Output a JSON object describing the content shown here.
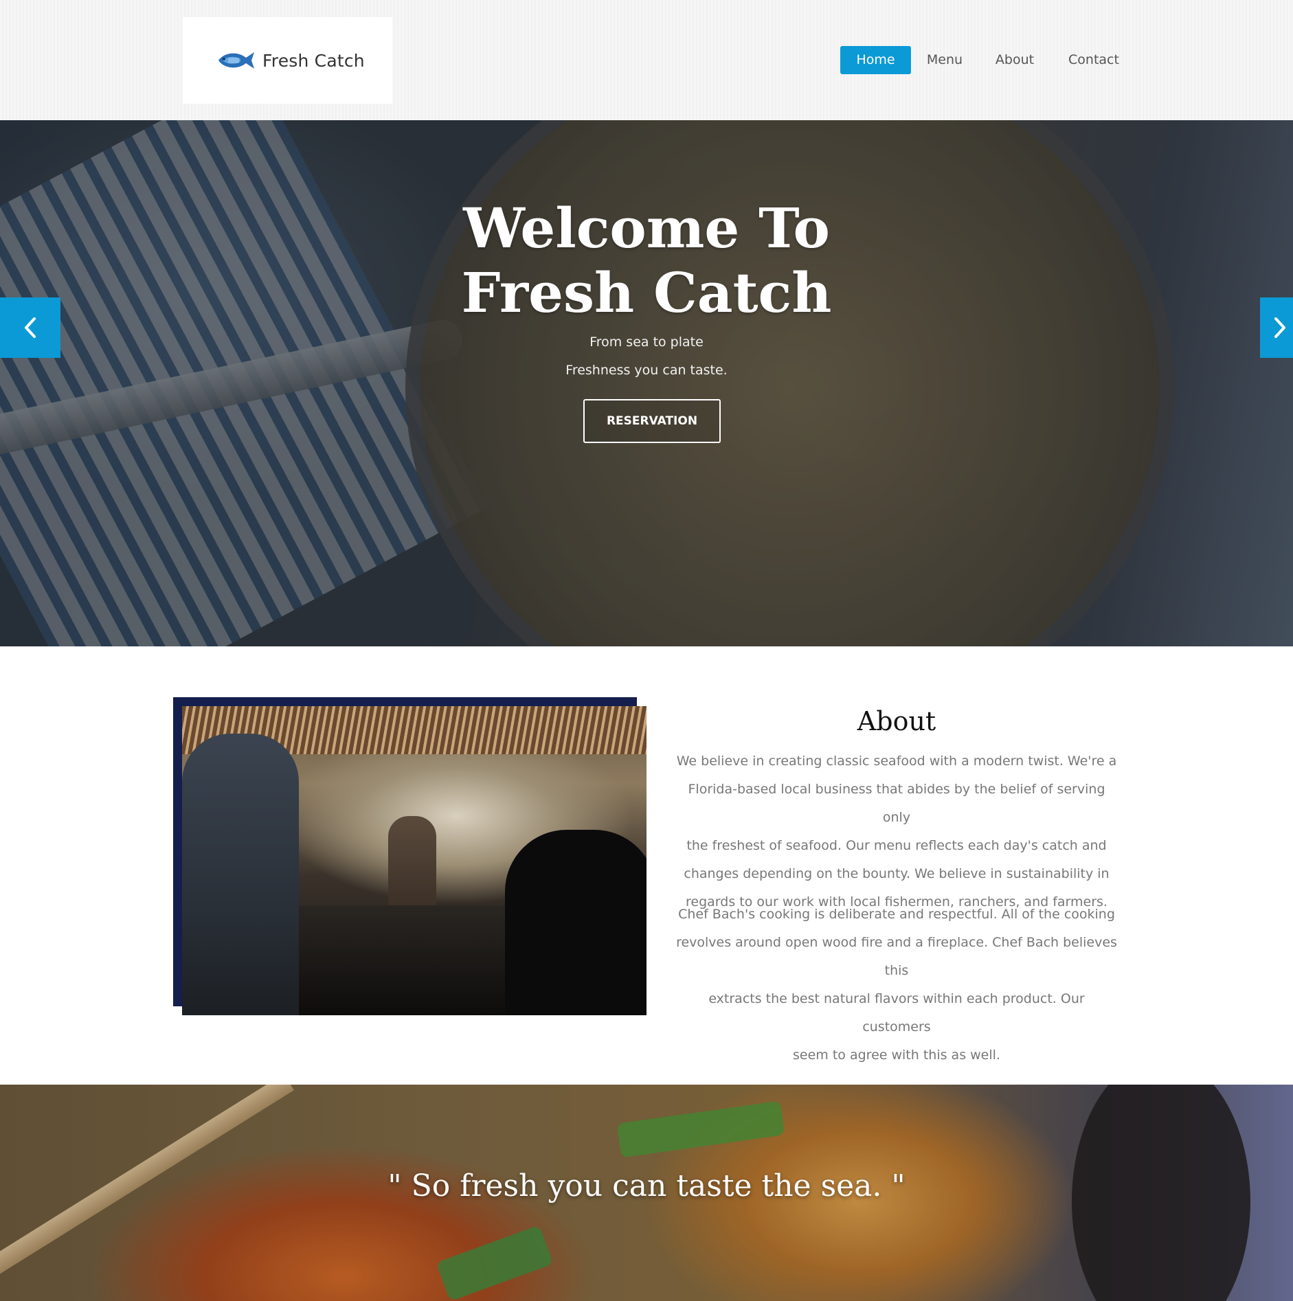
{
  "brand": {
    "name": "Fresh Catch",
    "logo_icon": "fish-icon",
    "accent_color": "#0b9ad6"
  },
  "nav": {
    "items": [
      {
        "label": "Home",
        "active": true
      },
      {
        "label": "Menu",
        "active": false
      },
      {
        "label": "About",
        "active": false
      },
      {
        "label": "Contact",
        "active": false
      }
    ]
  },
  "hero": {
    "title_line1": "Welcome To",
    "title_line2": "Fresh Catch",
    "subtitle_line1": "From sea to plate",
    "subtitle_line2": "Freshness you can taste.",
    "button_label": "RESERVATION",
    "prev_icon": "chevron-left-icon",
    "next_icon": "chevron-right-icon"
  },
  "about": {
    "heading": "About",
    "paragraph1_lines": [
      "We believe in creating classic seafood with a modern twist. We're a",
      "Florida-based local business that abides by the belief of serving only",
      "the freshest of seafood. Our menu reflects each day's catch and",
      "changes depending on the bounty. We believe in sustainability in",
      "regards to our work with local fishermen, ranchers, and farmers."
    ],
    "paragraph2_lines": [
      "Chef Bach's cooking is deliberate and respectful. All of the cooking",
      "revolves around open wood fire and a fireplace. Chef Bach believes this",
      "extracts the best natural flavors within each product. Our customers",
      "seem to agree with this as well."
    ]
  },
  "quote": {
    "text": "\" So fresh you can taste the sea. \""
  }
}
